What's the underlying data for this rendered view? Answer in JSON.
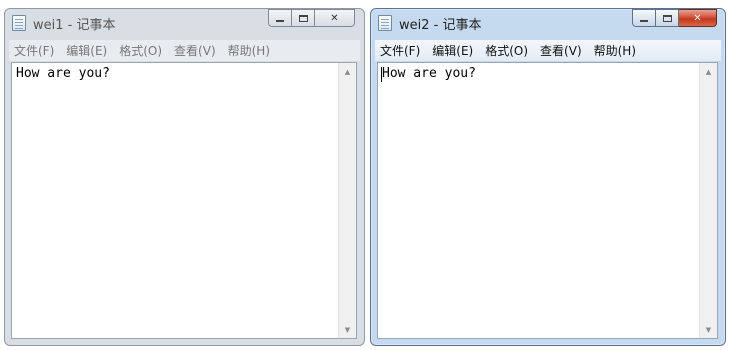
{
  "windows": [
    {
      "title": "wei1 - 记事本",
      "state": "inactive",
      "menu": [
        "文件(F)",
        "编辑(E)",
        "格式(O)",
        "查看(V)",
        "帮助(H)"
      ],
      "content": "How are you?",
      "icons": [
        "notepad-icon",
        "minimize-icon",
        "maximize-icon",
        "close-icon",
        "scroll-up-icon",
        "scroll-down-icon"
      ]
    },
    {
      "title": "wei2 - 记事本",
      "state": "active",
      "menu": [
        "文件(F)",
        "编辑(E)",
        "格式(O)",
        "查看(V)",
        "帮助(H)"
      ],
      "content": "How are you?",
      "icons": [
        "notepad-icon",
        "minimize-icon",
        "maximize-icon",
        "close-icon",
        "scroll-up-icon",
        "scroll-down-icon"
      ]
    }
  ],
  "colors": {
    "active_titlebar": "#c6daef",
    "inactive_titlebar": "#d9dee4",
    "close_button_active": "#c2361d"
  }
}
